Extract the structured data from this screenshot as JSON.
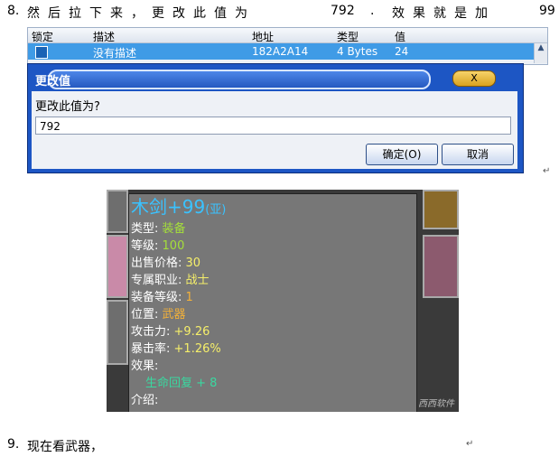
{
  "step8": {
    "number": "8.",
    "text_a": "然后拉下来，更改此值为",
    "value": "792",
    "dot": ".",
    "text_b": "效果就是加",
    "value2": "99"
  },
  "table": {
    "headers": [
      "锁定",
      "描述",
      "地址",
      "类型",
      "值"
    ],
    "row": {
      "desc": "没有描述",
      "address": "182A2A14",
      "type": "4 Bytes",
      "value": "24"
    }
  },
  "dialog": {
    "title": "更改值",
    "close_label": "X",
    "prompt": "更改此值为?",
    "input_value": "792",
    "ok_label": "确定(O)",
    "cancel_label": "取消"
  },
  "paragraph_mark": "↵",
  "tooltip": {
    "name": "木剑",
    "plus": "+99",
    "suffix": "(亚)",
    "type_label": "类型:",
    "type_value": "装备",
    "level_label": "等级:",
    "level_value": "100",
    "price_label": "出售价格:",
    "price_value": "30",
    "class_label": "专属职业:",
    "class_value": "战士",
    "equip_level_label": "装备等级:",
    "equip_level_value": "1",
    "position_label": "位置:",
    "position_value": "武器",
    "attack_label": "攻击力:",
    "attack_value": "+9.26",
    "crit_label": "暴击率:",
    "crit_value": "+1.26%",
    "effect_label": "效果:",
    "effect_value": "生命回复 + 8",
    "intro_label": "介绍:"
  },
  "watermark": "西西软件园",
  "step9": {
    "number": "9.",
    "text": "现在看武器，"
  }
}
